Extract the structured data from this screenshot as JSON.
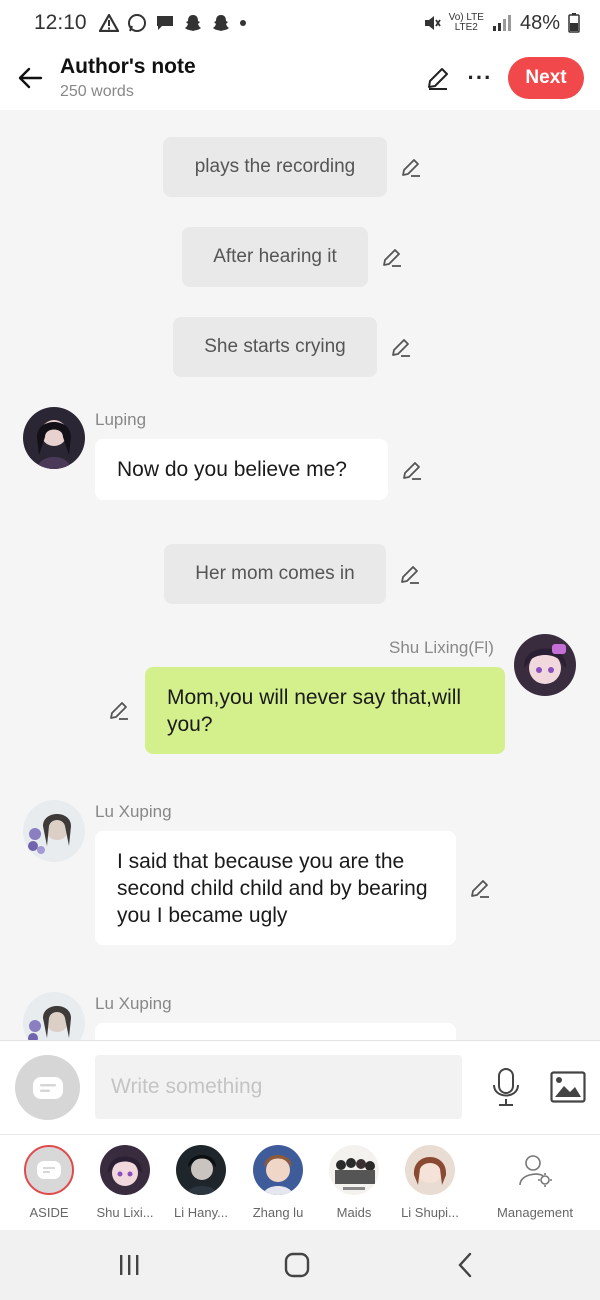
{
  "status_bar": {
    "time": "12:10",
    "network_top": "Vo) LTE",
    "network_bottom": "LTE2",
    "battery": "48%"
  },
  "header": {
    "title": "Author's note",
    "word_count": "250 words",
    "next_label": "Next"
  },
  "messages": [
    {
      "type": "aside",
      "text": "plays the recording"
    },
    {
      "type": "aside",
      "text": "After hearing it"
    },
    {
      "type": "aside",
      "text": "She starts crying"
    },
    {
      "type": "left",
      "name": "Luping",
      "text": "Now do you believe me?"
    },
    {
      "type": "aside",
      "text": "Her mom comes in"
    },
    {
      "type": "right",
      "name": "Shu Lixing(Fl)",
      "text": "Mom,you will never say that,will you?"
    },
    {
      "type": "left",
      "name": "Lu Xuping",
      "text": "I said that because you are the second child child and by bearing you I became ugly"
    },
    {
      "type": "left",
      "name": "Lu Xuping",
      "text": ""
    }
  ],
  "input": {
    "placeholder": "Write something"
  },
  "characters": [
    {
      "label": "ASIDE"
    },
    {
      "label": "Shu Lixi..."
    },
    {
      "label": "Li Hany..."
    },
    {
      "label": "Zhang lu"
    },
    {
      "label": "Maids"
    },
    {
      "label": "Li Shupi..."
    },
    {
      "label": "Management"
    }
  ],
  "colors": {
    "accent": "#f0484b",
    "own_bubble": "#d4f08c",
    "aside_bubble": "#e9e9e9",
    "background": "#f5f5f5"
  }
}
